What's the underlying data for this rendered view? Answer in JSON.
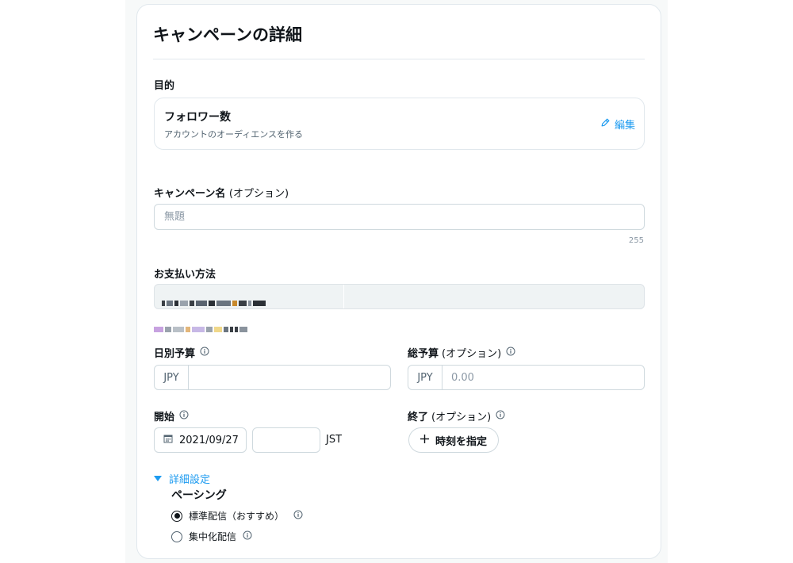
{
  "page": {
    "title": "キャンペーンの詳細"
  },
  "objective": {
    "label": "目的",
    "name": "フォロワー数",
    "description": "アカウントのオーディエンスを作る",
    "edit_label": "編集"
  },
  "campaign_name": {
    "label": "キャンペーン名",
    "optional": "(オプション)",
    "placeholder": "無題",
    "value": "",
    "counter": "255"
  },
  "payment": {
    "label": "お支払い方法"
  },
  "daily_budget": {
    "label": "日別予算",
    "currency": "JPY",
    "value": "",
    "placeholder": ""
  },
  "total_budget": {
    "label": "総予算",
    "optional": "(オプション)",
    "currency": "JPY",
    "placeholder": "0.00"
  },
  "start": {
    "label": "開始",
    "date": "2021/09/27",
    "time": "",
    "timezone": "JST"
  },
  "end": {
    "label": "終了",
    "optional": "(オプション)",
    "button_label": "時刻を指定"
  },
  "advanced": {
    "toggle_label": "詳細設定",
    "pacing_title": "ペーシング",
    "options": [
      {
        "label": "標準配信（おすすめ）",
        "selected": true
      },
      {
        "label": "集中化配信",
        "selected": false
      }
    ]
  },
  "colors": {
    "accent": "#1d9bf0",
    "text": "#0f1419",
    "muted": "#536471",
    "border": "#cfd9de"
  }
}
